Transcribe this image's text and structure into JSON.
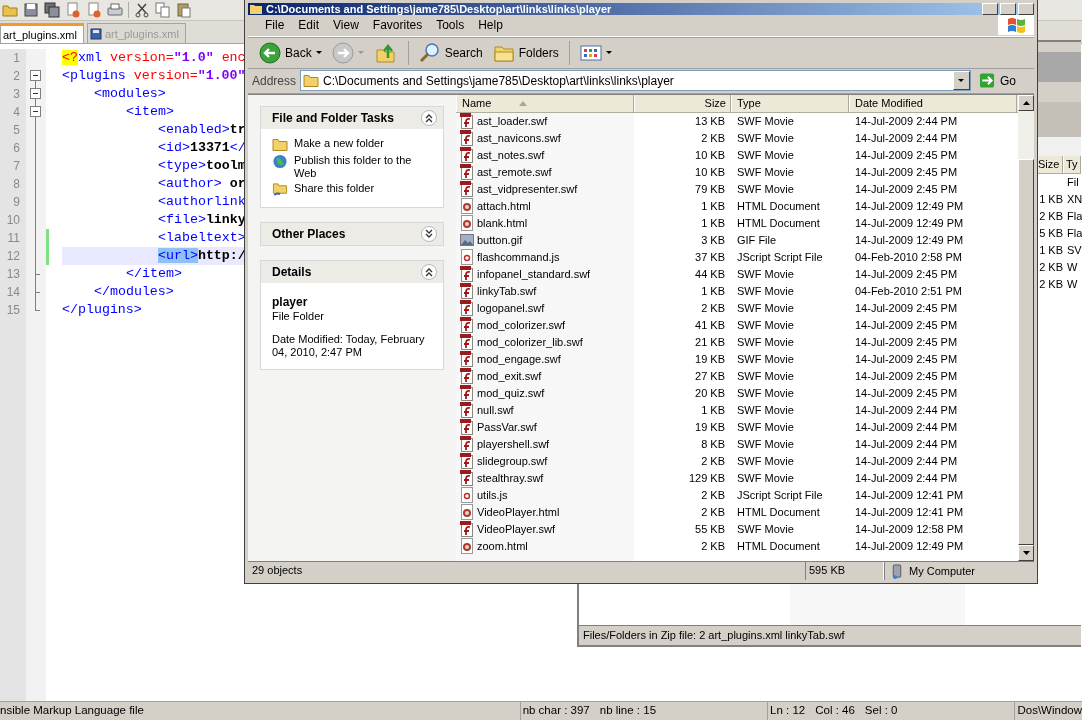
{
  "editor": {
    "tabs": [
      {
        "label": "art_plugins.xml",
        "selected": true
      },
      {
        "label": "art_plugins.xml",
        "selected": false
      }
    ],
    "lines": [
      {
        "number": "1",
        "changed": false,
        "current": false,
        "parts": [
          {
            "kind": "pi",
            "text": "<?"
          },
          {
            "kind": "tag",
            "text": "xml"
          },
          {
            "kind": "attr",
            "text": " version="
          },
          {
            "kind": "value",
            "text": "\"1.0\""
          },
          {
            "kind": "attr",
            "text": " enc"
          }
        ]
      },
      {
        "number": "2",
        "kind": "open",
        "changed": false,
        "current": false,
        "parts": [
          {
            "kind": "tag",
            "text": "<plugins"
          },
          {
            "kind": "attr",
            "text": " version="
          },
          {
            "kind": "value",
            "text": "\"1.00\""
          }
        ],
        "children": [
          {
            "number": "3",
            "kind": "open",
            "changed": false,
            "current": false,
            "parts": [
              {
                "kind": "tag",
                "text": "<modules>"
              }
            ],
            "children": [
              {
                "number": "4",
                "kind": "open",
                "changed": false,
                "current": false,
                "parts": [
                  {
                    "kind": "tag",
                    "text": "<item>"
                  }
                ],
                "children": [
                  {
                    "number": "5",
                    "changed": false,
                    "current": false,
                    "parts": [
                      {
                        "kind": "tag",
                        "text": "<enabled>"
                      },
                      {
                        "kind": "text",
                        "text": "tr"
                      }
                    ]
                  },
                  {
                    "number": "6",
                    "changed": false,
                    "current": false,
                    "parts": [
                      {
                        "kind": "tag",
                        "text": "<id>"
                      },
                      {
                        "kind": "text",
                        "text": "13371"
                      },
                      {
                        "kind": "tag",
                        "text": "</"
                      }
                    ]
                  },
                  {
                    "number": "7",
                    "changed": false,
                    "current": false,
                    "parts": [
                      {
                        "kind": "tag",
                        "text": "<type>"
                      },
                      {
                        "kind": "text",
                        "text": "toolm"
                      }
                    ]
                  },
                  {
                    "number": "8",
                    "changed": false,
                    "current": false,
                    "parts": [
                      {
                        "kind": "tag",
                        "text": "<author>"
                      },
                      {
                        "kind": "text",
                        "text": " or"
                      }
                    ]
                  },
                  {
                    "number": "9",
                    "changed": false,
                    "current": false,
                    "parts": [
                      {
                        "kind": "tag",
                        "text": "<authorlink"
                      }
                    ]
                  },
                  {
                    "number": "10",
                    "changed": false,
                    "current": false,
                    "parts": [
                      {
                        "kind": "tag",
                        "text": "<file>"
                      },
                      {
                        "kind": "text",
                        "text": "linky"
                      }
                    ]
                  },
                  {
                    "number": "11",
                    "changed": true,
                    "current": false,
                    "parts": [
                      {
                        "kind": "tag",
                        "text": "<labeltext>"
                      }
                    ]
                  },
                  {
                    "number": "12",
                    "changed": true,
                    "current": true,
                    "parts": [
                      {
                        "kind": "match",
                        "text": "<url>"
                      },
                      {
                        "kind": "text",
                        "text": "http:/"
                      }
                    ]
                  }
                ]
              },
              {
                "number": "13",
                "kind": "close",
                "changed": false,
                "current": false,
                "parts": [
                  {
                    "kind": "tag",
                    "text": "</item>"
                  }
                ]
              }
            ]
          },
          {
            "number": "14",
            "kind": "close",
            "changed": false,
            "current": false,
            "parts": [
              {
                "kind": "tag",
                "text": "</modules>"
              }
            ]
          }
        ]
      },
      {
        "number": "15",
        "kind": "close",
        "changed": false,
        "current": false,
        "parts": [
          {
            "kind": "tag",
            "text": "</plugins>"
          }
        ]
      }
    ],
    "status_bar": {
      "file_type": "nsible Markup Language file",
      "chars": "nb char : 397",
      "line_count": "nb line : 15",
      "ln": "Ln : 12",
      "col": "Col : 46",
      "sel": "Sel : 0",
      "eol": "Dos\\Window"
    }
  },
  "zip_window": {
    "columns": [
      "Size",
      "Ty"
    ],
    "rows": [
      {
        "type": "Fil"
      },
      {
        "size": "1 KB",
        "type": "XN"
      },
      {
        "size": "2 KB",
        "type": "Fla"
      },
      {
        "size": "5 KB",
        "type": "Fla"
      },
      {
        "size": "1 KB",
        "type": "SV"
      },
      {
        "size": "2 KB",
        "type": "W"
      },
      {
        "size": "2 KB",
        "type": "W"
      }
    ],
    "status": "Files/Folders in Zip file: 2 art_plugins.xml linkyTab.swf"
  },
  "explorer": {
    "title": "C:\\Documents and Settings\\jame785\\Desktop\\art\\links\\links\\player",
    "menu": [
      "File",
      "Edit",
      "View",
      "Favorites",
      "Tools",
      "Help"
    ],
    "toolbar": {
      "back": "Back",
      "forward_disabled": true,
      "search": "Search",
      "folders": "Folders"
    },
    "address": {
      "label": "Address",
      "value": "C:\\Documents and Settings\\jame785\\Desktop\\art\\links\\links\\player",
      "go": "Go"
    },
    "panels": [
      {
        "kind": "tasks",
        "title": "File and Folder Tasks",
        "expanded": true,
        "items": [
          {
            "kind": "new-folder",
            "label": "Make a new folder"
          },
          {
            "kind": "web",
            "label": "Publish this folder to the Web"
          },
          {
            "kind": "share",
            "label": "Share this folder"
          }
        ]
      },
      {
        "title": "Other Places",
        "expanded": false
      },
      {
        "kind": "details",
        "title": "Details",
        "expanded": true,
        "name": "player",
        "type": "File Folder",
        "modified": "Date Modified: Today, February 04, 2010, 2:47 PM"
      }
    ],
    "columns": [
      {
        "label": "Name",
        "sorted": true
      },
      {
        "label": "Size",
        "sorted": false
      },
      {
        "label": "Type",
        "sorted": false
      },
      {
        "label": "Date Modified",
        "sorted": false
      }
    ],
    "files": [
      {
        "kind": "swf",
        "name": "ast_loader.swf",
        "size": "13 KB",
        "type": "SWF Movie",
        "modified": "14-Jul-2009 2:44 PM"
      },
      {
        "kind": "swf",
        "name": "ast_navicons.swf",
        "size": "2 KB",
        "type": "SWF Movie",
        "modified": "14-Jul-2009 2:44 PM"
      },
      {
        "kind": "swf",
        "name": "ast_notes.swf",
        "size": "10 KB",
        "type": "SWF Movie",
        "modified": "14-Jul-2009 2:45 PM"
      },
      {
        "kind": "swf",
        "name": "ast_remote.swf",
        "size": "10 KB",
        "type": "SWF Movie",
        "modified": "14-Jul-2009 2:45 PM"
      },
      {
        "kind": "swf",
        "name": "ast_vidpresenter.swf",
        "size": "79 KB",
        "type": "SWF Movie",
        "modified": "14-Jul-2009 2:45 PM"
      },
      {
        "kind": "html",
        "name": "attach.html",
        "size": "1 KB",
        "type": "HTML Document",
        "modified": "14-Jul-2009 12:49 PM"
      },
      {
        "kind": "html",
        "name": "blank.html",
        "size": "1 KB",
        "type": "HTML Document",
        "modified": "14-Jul-2009 12:49 PM"
      },
      {
        "kind": "gif",
        "name": "button.gif",
        "size": "3 KB",
        "type": "GIF File",
        "modified": "14-Jul-2009 12:49 PM"
      },
      {
        "kind": "js",
        "name": "flashcommand.js",
        "size": "37 KB",
        "type": "JScript Script File",
        "modified": "04-Feb-2010 2:58 PM"
      },
      {
        "kind": "swf",
        "name": "infopanel_standard.swf",
        "size": "44 KB",
        "type": "SWF Movie",
        "modified": "14-Jul-2009 2:45 PM"
      },
      {
        "kind": "swf",
        "name": "linkyTab.swf",
        "size": "1 KB",
        "type": "SWF Movie",
        "modified": "04-Feb-2010 2:51 PM"
      },
      {
        "kind": "swf",
        "name": "logopanel.swf",
        "size": "2 KB",
        "type": "SWF Movie",
        "modified": "14-Jul-2009 2:45 PM"
      },
      {
        "kind": "swf",
        "name": "mod_colorizer.swf",
        "size": "41 KB",
        "type": "SWF Movie",
        "modified": "14-Jul-2009 2:45 PM"
      },
      {
        "kind": "swf",
        "name": "mod_colorizer_lib.swf",
        "size": "21 KB",
        "type": "SWF Movie",
        "modified": "14-Jul-2009 2:45 PM"
      },
      {
        "kind": "swf",
        "name": "mod_engage.swf",
        "size": "19 KB",
        "type": "SWF Movie",
        "modified": "14-Jul-2009 2:45 PM"
      },
      {
        "kind": "swf",
        "name": "mod_exit.swf",
        "size": "27 KB",
        "type": "SWF Movie",
        "modified": "14-Jul-2009 2:45 PM"
      },
      {
        "kind": "swf",
        "name": "mod_quiz.swf",
        "size": "20 KB",
        "type": "SWF Movie",
        "modified": "14-Jul-2009 2:45 PM"
      },
      {
        "kind": "swf",
        "name": "null.swf",
        "size": "1 KB",
        "type": "SWF Movie",
        "modified": "14-Jul-2009 2:44 PM"
      },
      {
        "kind": "swf",
        "name": "PassVar.swf",
        "size": "19 KB",
        "type": "SWF Movie",
        "modified": "14-Jul-2009 2:44 PM"
      },
      {
        "kind": "swf",
        "name": "playershell.swf",
        "size": "8 KB",
        "type": "SWF Movie",
        "modified": "14-Jul-2009 2:44 PM"
      },
      {
        "kind": "swf",
        "name": "slidegroup.swf",
        "size": "2 KB",
        "type": "SWF Movie",
        "modified": "14-Jul-2009 2:44 PM"
      },
      {
        "kind": "swf",
        "name": "stealthray.swf",
        "size": "129 KB",
        "type": "SWF Movie",
        "modified": "14-Jul-2009 2:44 PM"
      },
      {
        "kind": "js",
        "name": "utils.js",
        "size": "2 KB",
        "type": "JScript Script File",
        "modified": "14-Jul-2009 12:41 PM"
      },
      {
        "kind": "html",
        "name": "VideoPlayer.html",
        "size": "2 KB",
        "type": "HTML Document",
        "modified": "14-Jul-2009 12:41 PM"
      },
      {
        "kind": "swf",
        "name": "VideoPlayer.swf",
        "size": "55 KB",
        "type": "SWF Movie",
        "modified": "14-Jul-2009 12:58 PM"
      },
      {
        "kind": "html",
        "name": "zoom.html",
        "size": "2 KB",
        "type": "HTML Document",
        "modified": "14-Jul-2009 12:49 PM"
      }
    ],
    "status": {
      "objects": "29 objects",
      "size": "595 KB",
      "zone": "My Computer"
    }
  }
}
